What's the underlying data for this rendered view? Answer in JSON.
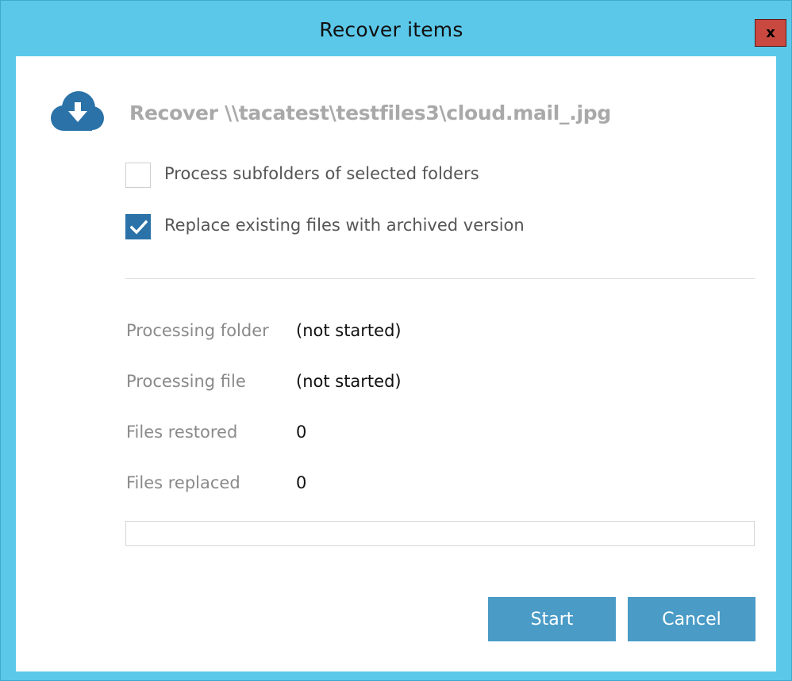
{
  "window": {
    "title": "Recover items",
    "close_label": "x"
  },
  "header": {
    "heading": "Recover \\\\tacatest\\testfiles3\\cloud.mail_.jpg",
    "icon": "cloud-download-icon"
  },
  "options": [
    {
      "label": "Process subfolders of selected folders",
      "checked": false
    },
    {
      "label": "Replace existing files with archived version",
      "checked": true
    }
  ],
  "stats": [
    {
      "label": "Processing folder",
      "value": "(not started)"
    },
    {
      "label": "Processing file",
      "value": "(not started)"
    },
    {
      "label": "Files restored",
      "value": "0"
    },
    {
      "label": "Files replaced",
      "value": "0"
    }
  ],
  "progress": {
    "percent": 0
  },
  "buttons": {
    "start_label": "Start",
    "cancel_label": "Cancel"
  },
  "colors": {
    "title_bar": "#5bc8ea",
    "close_button": "#c9483f",
    "accent": "#4a9cc7",
    "checkbox_checked": "#2a72a8",
    "icon": "#2a72a8"
  }
}
